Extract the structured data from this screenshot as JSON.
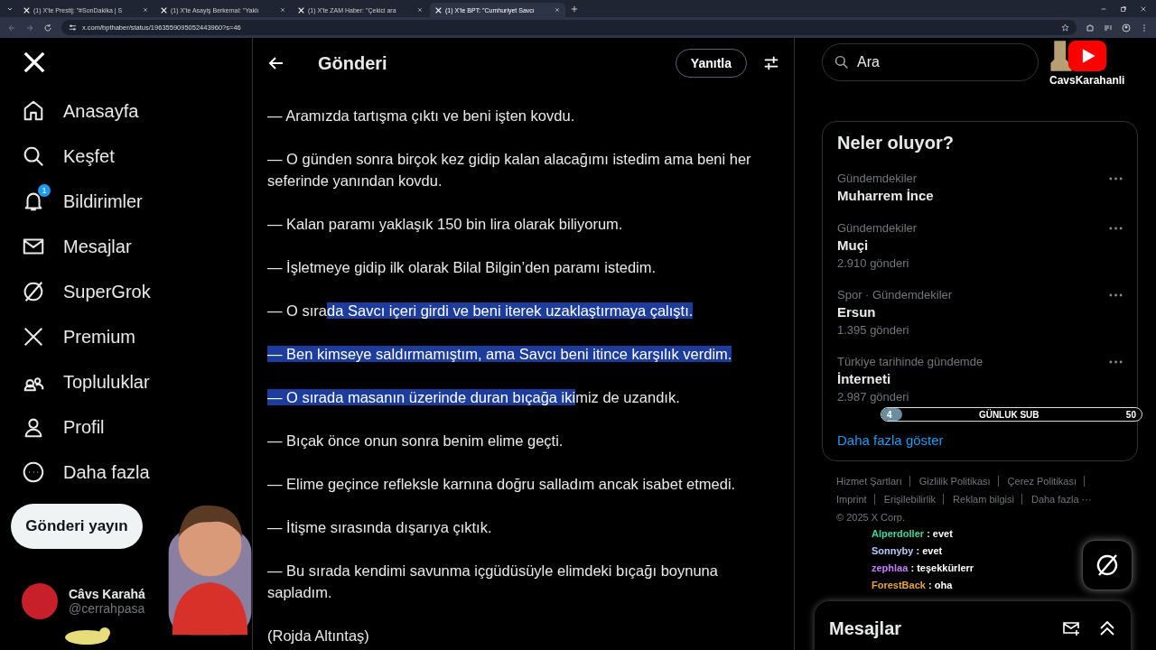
{
  "browser": {
    "tabs": [
      {
        "title": "(1) X'te Prestij: \"#SonDakika | S",
        "selected": false
      },
      {
        "title": "(1) X'te Asayiş Berkemal: \"Yaklı",
        "selected": false
      },
      {
        "title": "(1) X'te ZAM Haber: \"Çekici ara",
        "selected": false
      },
      {
        "title": "(1) X'te BPT: \"Cumhuriyet Savcı",
        "selected": true
      }
    ],
    "address": "x.com/bpthaber/status/1963559095052443960?s=46"
  },
  "sidebar": {
    "items": [
      {
        "label": "Anasayfa",
        "kind": "home"
      },
      {
        "label": "Keşfet",
        "kind": "search"
      },
      {
        "label": "Bildirimler",
        "kind": "bell",
        "badge": "1"
      },
      {
        "label": "Mesajlar",
        "kind": "mail"
      },
      {
        "label": "SuperGrok",
        "kind": "grok"
      },
      {
        "label": "Premium",
        "kind": "x"
      },
      {
        "label": "Topluluklar",
        "kind": "people"
      },
      {
        "label": "Profil",
        "kind": "person"
      },
      {
        "label": "Daha fazla",
        "kind": "more"
      }
    ],
    "post_button": "Gönderi yayın",
    "account": {
      "name": "Câvs Karahá",
      "handle": "@cerrahpasa"
    }
  },
  "post": {
    "header_title": "Gönderi",
    "reply_button": "Yanıtla",
    "paragraphs": [
      {
        "parts": [
          {
            "text": "— Aramızda tartışma çıktı ve beni işten kovdu.",
            "selected": false
          }
        ]
      },
      {
        "parts": [
          {
            "text": "— O günden sonra birçok kez gidip kalan alacağımı istedim ama beni her seferinde yanından kovdu.",
            "selected": false
          }
        ]
      },
      {
        "parts": [
          {
            "text": "— Kalan paramı yaklaşık 150 bin lira olarak biliyorum.",
            "selected": false
          }
        ]
      },
      {
        "parts": [
          {
            "text": "— İşletmeye gidip ilk olarak Bilal Bilgin’den paramı istedim.",
            "selected": false
          }
        ]
      },
      {
        "parts": [
          {
            "text": "— O sıra",
            "selected": false
          },
          {
            "text": "da Savcı içeri girdi ve beni iterek uzaklaştırmaya çalıştı.",
            "selected": true
          }
        ]
      },
      {
        "parts": [
          {
            "text": "— Ben kimseye saldırmamıştım, ama Savcı beni itince karşılık verdim.",
            "selected": true
          }
        ]
      },
      {
        "parts": [
          {
            "text": "— O sırada masanın üzerinde duran bıçağa iki",
            "selected": true
          },
          {
            "text": "miz de uzandık.",
            "selected": false
          }
        ]
      },
      {
        "parts": [
          {
            "text": "— Bıçak önce onun sonra benim elime geçti.",
            "selected": false
          }
        ]
      },
      {
        "parts": [
          {
            "text": "— Elime geçince refleksle karnına doğru salladım ancak isabet etmedi.",
            "selected": false
          }
        ]
      },
      {
        "parts": [
          {
            "text": "— İtişme sırasında dışarıya çıktık.",
            "selected": false
          }
        ]
      },
      {
        "parts": [
          {
            "text": "— Bu sırada kendimi savunma içgüdüsüyle elimdeki bıçağı boynuna sapladım.",
            "selected": false
          }
        ]
      },
      {
        "parts": [
          {
            "text": "(Rojda Altıntaş)",
            "selected": false
          }
        ]
      }
    ]
  },
  "right": {
    "search": {
      "placeholder": "Ara"
    },
    "trends": {
      "title": "Neler oluyor?",
      "items": [
        {
          "category": "Gündemdekiler",
          "name": "Muharrem İnce"
        },
        {
          "category": "Gündemdekiler",
          "name": "Muçi",
          "count": "2.910 gönderi"
        },
        {
          "category": "Spor · Gündemdekiler",
          "name": "Ersun",
          "count": "1.395 gönderi"
        },
        {
          "category": "Türkiye tarihinde gündemde",
          "name": "İnterneti",
          "count": "2.987 gönderi"
        }
      ],
      "show_more": "Daha fazla göster"
    },
    "footer": {
      "links": [
        "Hizmet Şartları",
        "Gizlilik Politikası",
        "Çerez Politikası",
        "Imprint",
        "Erişilebilirlik",
        "Reklam bilgisi"
      ],
      "more": "Daha fazla ···",
      "copyright": "© 2025 X Corp."
    },
    "messages_title": "Mesajlar"
  },
  "overlay": {
    "channel_name": "CavsKarahanli",
    "sub_goal": {
      "current": "4",
      "label": "GÜNLUK SUB",
      "target": "50",
      "level": 0.08
    },
    "chat": [
      {
        "user": "Alperdoller",
        "message": ": evet",
        "color": "#3ed6a0"
      },
      {
        "user": "Sonnyby",
        "message": ": evet",
        "color": "#b9c8ff"
      },
      {
        "user": "zephlaa",
        "message": ": teşekkürlerr",
        "color": "#c77dff"
      },
      {
        "user": "ForestBack",
        "message": ": oha",
        "color": "#e8a33a"
      }
    ]
  }
}
